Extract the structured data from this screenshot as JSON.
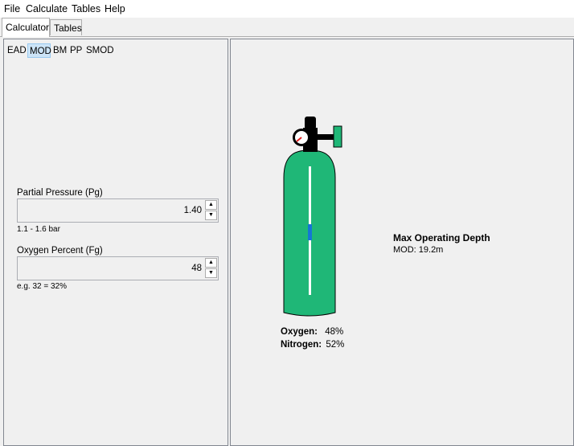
{
  "menu": {
    "file": "File",
    "calculate": "Calculate",
    "tables": "Tables",
    "help": "Help"
  },
  "tabs": {
    "calculator": "Calculator",
    "tables": "Tables"
  },
  "modes": {
    "ead": "EAD",
    "mod": "MOD",
    "bm": "BM",
    "pp": "PP",
    "smod": "SMOD",
    "selected": "MOD"
  },
  "partial_pressure": {
    "label": "Partial Pressure (Pg)",
    "value": "1.40",
    "hint": "1.1 - 1.6 bar"
  },
  "oxygen_percent": {
    "label": "Oxygen Percent (Fg)",
    "value": "48",
    "hint": "e.g. 32 = 32%"
  },
  "mix": {
    "oxygen_label": "Oxygen:",
    "oxygen_value": "48%",
    "nitrogen_label": "Nitrogen:",
    "nitrogen_value": "52%"
  },
  "result": {
    "title": "Max Operating Depth",
    "value": "MOD: 19.2m"
  },
  "cylinder": {
    "body_color": "#1fb777",
    "valve_color": "#000000",
    "handwheel_color": "#1fb777",
    "marker_color": "#1477d4",
    "needle_color": "#e02020"
  }
}
